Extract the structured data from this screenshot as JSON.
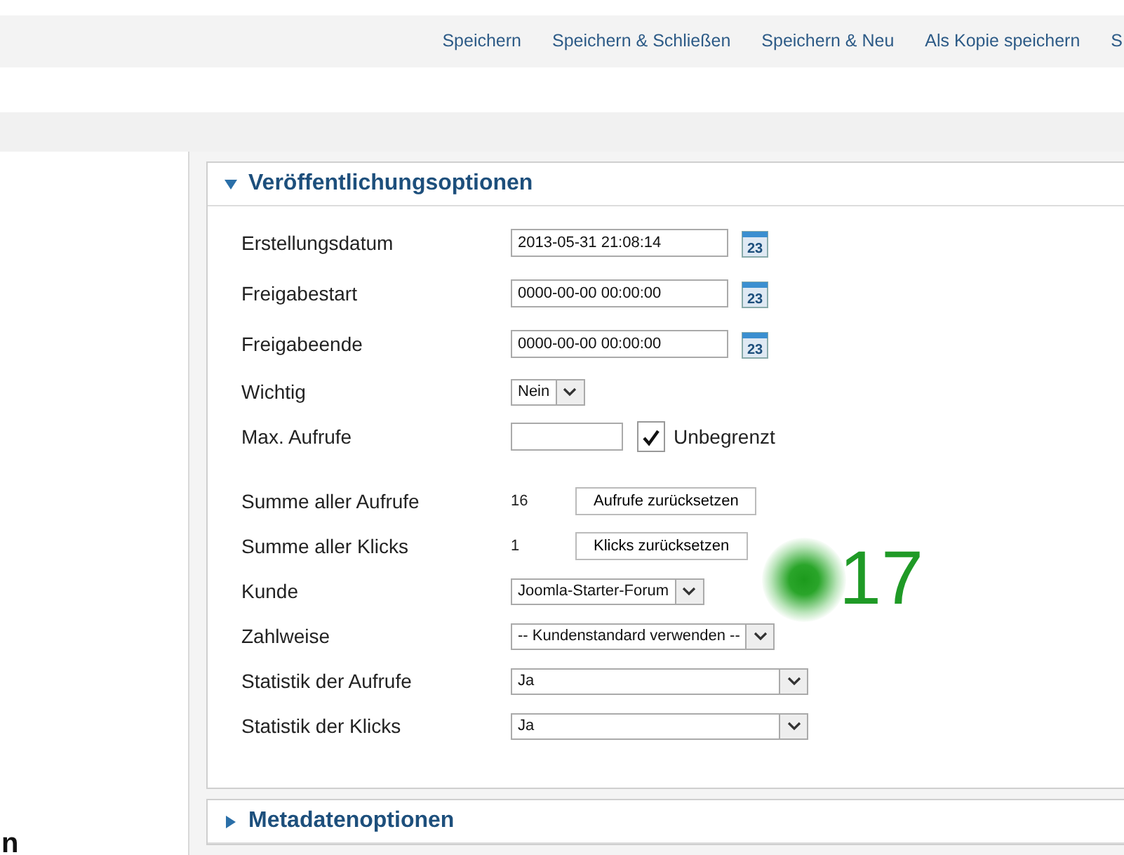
{
  "toolbar": {
    "buttons": [
      {
        "label": "Speichern"
      },
      {
        "label": "Speichern & Schließen"
      },
      {
        "label": "Speichern & Neu"
      },
      {
        "label": "Als Kopie speichern"
      },
      {
        "label": "S"
      }
    ]
  },
  "publishing_panel": {
    "title": "Veröffentlichungsoptionen",
    "expanded": true,
    "fields": [
      {
        "kind": "date",
        "label": "Erstellungsdatum",
        "value": "2013-05-31 21:08:14",
        "calendar_day": "23"
      },
      {
        "kind": "date",
        "label": "Freigabestart",
        "value": "0000-00-00 00:00:00",
        "calendar_day": "23"
      },
      {
        "kind": "date",
        "label": "Freigabeende",
        "value": "0000-00-00 00:00:00",
        "calendar_day": "23"
      },
      {
        "kind": "select",
        "label": "Wichtig",
        "value": "Nein"
      },
      {
        "kind": "limit",
        "label": "Max. Aufrufe",
        "checkbox_label": "Unbegrenzt",
        "checked": true
      },
      {
        "kind": "counter",
        "label": "Summe aller Aufrufe",
        "value": "16",
        "button": "Aufrufe zurücksetzen"
      },
      {
        "kind": "counter",
        "label": "Summe aller Klicks",
        "value": "1",
        "button": "Klicks zurücksetzen"
      },
      {
        "kind": "select",
        "label": "Kunde",
        "value": "Joomla-Starter-Forum"
      },
      {
        "kind": "select",
        "label": "Zahlweise",
        "value": "-- Kundenstandard verwenden --"
      },
      {
        "kind": "wide_select",
        "label": "Statistik der Aufrufe",
        "value": "Ja"
      },
      {
        "kind": "wide_select",
        "label": "Statistik der Klicks",
        "value": "Ja"
      }
    ]
  },
  "metadata_panel": {
    "title": "Metadatenoptionen",
    "expanded": false
  },
  "annotation": {
    "marker": "17"
  },
  "edge_fragment": "n"
}
